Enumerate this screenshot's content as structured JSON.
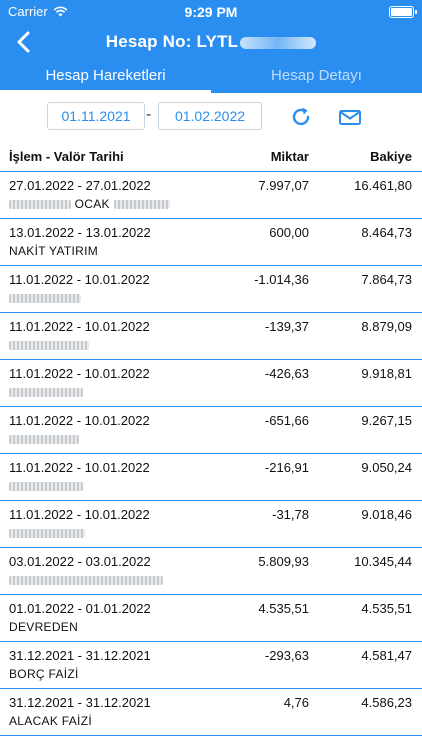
{
  "status": {
    "carrier": "Carrier",
    "time": "9:29 PM",
    "battery_level": 1.0
  },
  "nav": {
    "title": "Hesap No: LYTL"
  },
  "tabs": [
    {
      "label": "Hesap Hareketleri",
      "active": true
    },
    {
      "label": "Hesap Detayı",
      "active": false
    }
  ],
  "filter": {
    "start_date": "01.11.2021",
    "separator": "-",
    "end_date": "01.02.2022"
  },
  "table": {
    "headers": {
      "date": "İşlem - Valör Tarihi",
      "amount": "Miktar",
      "balance": "Bakiye"
    },
    "rows": [
      {
        "dates": "27.01.2022 - 27.01.2022",
        "desc": "OCAK",
        "amount": "7.997,07",
        "balance": "16.461,80"
      },
      {
        "dates": "13.01.2022 - 13.01.2022",
        "desc": "NAKİT YATIRIM",
        "amount": "600,00",
        "balance": "8.464,73"
      },
      {
        "dates": "11.01.2022 - 10.01.2022",
        "desc": "",
        "amount": "-1.014,36",
        "balance": "7.864,73"
      },
      {
        "dates": "11.01.2022 - 10.01.2022",
        "desc": "",
        "amount": "-139,37",
        "balance": "8.879,09"
      },
      {
        "dates": "11.01.2022 - 10.01.2022",
        "desc": "",
        "amount": "-426,63",
        "balance": "9.918,81"
      },
      {
        "dates": "11.01.2022 - 10.01.2022",
        "desc": "",
        "amount": "-651,66",
        "balance": "9.267,15"
      },
      {
        "dates": "11.01.2022 - 10.01.2022",
        "desc": "",
        "amount": "-216,91",
        "balance": "9.050,24"
      },
      {
        "dates": "11.01.2022 - 10.01.2022",
        "desc": "",
        "amount": "-31,78",
        "balance": "9.018,46"
      },
      {
        "dates": "03.01.2022 - 03.01.2022",
        "desc": "",
        "amount": "5.809,93",
        "balance": "10.345,44"
      },
      {
        "dates": "01.01.2022 - 01.01.2022",
        "desc": "DEVREDEN",
        "amount": "4.535,51",
        "balance": "4.535,51"
      },
      {
        "dates": "31.12.2021 - 31.12.2021",
        "desc": "BORÇ FAİZİ",
        "amount": "-293,63",
        "balance": "4.581,47"
      },
      {
        "dates": "31.12.2021 - 31.12.2021",
        "desc": "ALACAK FAİZİ",
        "amount": "4,76",
        "balance": "4.586,23"
      }
    ]
  },
  "colors": {
    "accent": "#2a8ef0",
    "header_text": "#ffffff",
    "border": "#c9d3de"
  },
  "icons": [
    "wifi-icon",
    "battery-icon",
    "back-chevron-icon",
    "refresh-icon",
    "mail-icon"
  ]
}
